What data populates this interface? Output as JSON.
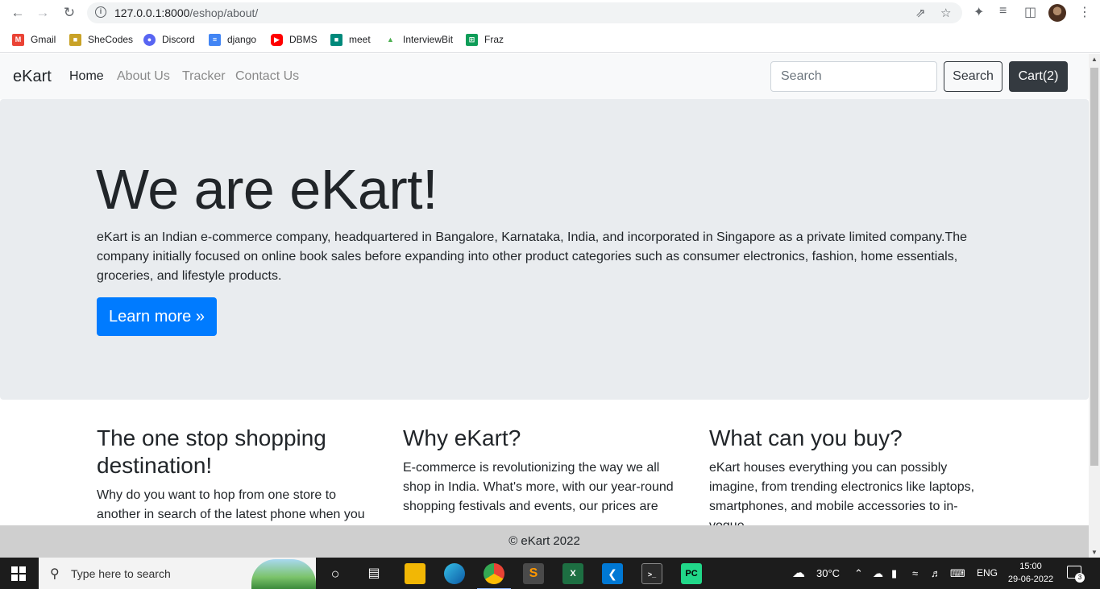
{
  "browser": {
    "url_host": "127.0.0.1:8000",
    "url_path": "/eshop/about/",
    "bookmarks": [
      {
        "label": "Gmail",
        "icon": "gmail-icon",
        "color": "#ea4335"
      },
      {
        "label": "SheCodes",
        "icon": "shecodes-icon",
        "color": "#b8860b"
      },
      {
        "label": "Discord",
        "icon": "discord-icon",
        "color": "#5865f2"
      },
      {
        "label": "django",
        "icon": "docs-icon",
        "color": "#4285f4"
      },
      {
        "label": "DBMS",
        "icon": "youtube-icon",
        "color": "#ff0000"
      },
      {
        "label": "meet",
        "icon": "meet-icon",
        "color": "#00897b"
      },
      {
        "label": "InterviewBit",
        "icon": "interviewbit-icon",
        "color": "#4caf50"
      },
      {
        "label": "Fraz",
        "icon": "sheets-icon",
        "color": "#0f9d58"
      }
    ]
  },
  "navbar": {
    "brand": "eKart",
    "links": [
      "Home",
      "About Us",
      "Tracker",
      "Contact Us"
    ],
    "search_placeholder": "Search",
    "search_button": "Search",
    "cart_button": "Cart(2)"
  },
  "hero": {
    "title": "We are eKart!",
    "description": "eKart is an Indian e-commerce company, headquartered in Bangalore, Karnataka, India, and incorporated in Singapore as a private limited company.The company initially focused on online book sales before expanding into other product categories such as consumer electronics, fashion, home essentials, groceries, and lifestyle products.",
    "button": "Learn more »"
  },
  "columns": [
    {
      "title": "The one stop shopping destination!",
      "text": "Why do you want to hop from one store to another in search of the latest phone when you"
    },
    {
      "title": "Why eKart?",
      "text": "E-commerce is revolutionizing the way we all shop in India. What's more, with our year-round shopping festivals and events, our prices are"
    },
    {
      "title": "What can you buy?",
      "text": "eKart houses everything you can possibly imagine, from trending electronics like laptops, smartphones, and mobile accessories to in-vogue"
    }
  ],
  "footer": "© eKart 2022",
  "taskbar": {
    "search_placeholder": "Type here to search",
    "weather": "30°C",
    "language": "ENG",
    "time": "15:00",
    "date": "29-06-2022",
    "notification_count": "3"
  }
}
